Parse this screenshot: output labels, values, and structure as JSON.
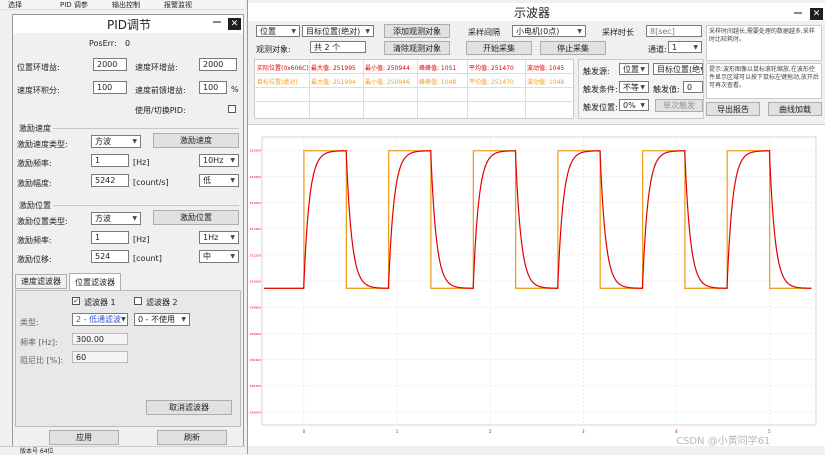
{
  "topbar": {
    "items": [
      "选择",
      "PID 调参",
      "输出控制",
      "报警监视"
    ]
  },
  "pid": {
    "title": "PID调节",
    "poserr_label": "PosErr:",
    "poserr_value": "0",
    "pos_gain_label": "位置环增益:",
    "pos_gain_value": "2000",
    "vel_gain_label": "速度环增益:",
    "vel_gain_value": "2000",
    "vel_int_label": "速度环积分:",
    "vel_int_value": "100",
    "vel_ff_label": "速度前馈增益:",
    "vel_ff_value": "100",
    "vel_ff_unit": "%",
    "switch_label": "使用/切换PID:",
    "vel_section": "激励速度",
    "vel_wave_label": "激励速度类型:",
    "vel_wave_value": "方波",
    "vel_btn": "激励速度",
    "vel_freq_label": "激励频率:",
    "vel_freq_value": "1",
    "vel_freq_unit": "[Hz]",
    "vel_freq_sel": "10Hz",
    "vel_amp_label": "激励幅度:",
    "vel_amp_value": "5242",
    "vel_amp_unit": "[count/s]",
    "vel_amp_sel": "低",
    "pos_section": "激励位置",
    "pos_wave_label": "激励位置类型:",
    "pos_wave_value": "方波",
    "pos_btn": "激励位置",
    "pos_freq_label": "激励频率:",
    "pos_freq_value": "1",
    "pos_freq_unit": "[Hz]",
    "pos_freq_sel": "1Hz",
    "pos_amp_label": "激励位移:",
    "pos_amp_value": "524",
    "pos_amp_unit": "[count]",
    "pos_amp_sel": "中",
    "tabs": [
      "速度滤波器",
      "位置滤波器"
    ],
    "filter1": "滤波器 1",
    "filter2": "滤波器 2",
    "type_label": "类型:",
    "type_value": "2 - 低通滤波",
    "type2_value": "0 - 不使用",
    "freq_label": "频率 [Hz]:",
    "freq_value": "300.00",
    "damp_label": "阻尼比 [%]:",
    "damp_value": "60",
    "filter_btn": "取消滤波器",
    "apply_btn": "应用",
    "refresh_btn": "刷新",
    "status": "版本号 64位"
  },
  "osc": {
    "title": "示波器",
    "ch_sel": "位置",
    "ch2_sel": "目标位置(绝对)",
    "add_btn": "添加观测对象",
    "trig_label": "采样间隔",
    "trig_sel": "小电机(0点)",
    "samp_label": "采样时长",
    "samp_value": "8[sec]",
    "obs_label": "观测对象:",
    "obs_value": "共 2 个",
    "clear_btn": "清除观测对象",
    "start_btn": "开始采集",
    "stop_btn": "停止采集",
    "chan_label": "通道:",
    "chan_value": "1",
    "rows": [
      {
        "name": "实际位置(0x606C)",
        "c1": "最大值: 251995",
        "c2": "最小值: 250944",
        "c3": "峰峰值: 1051",
        "c4": "平均值: 251470",
        "c5": "波动值: 1045"
      },
      {
        "name": "目标位置(绝对)",
        "c1": "最大值: 251994",
        "c2": "最小值: 250946",
        "c3": "峰峰值: 1048",
        "c4": "平均值: 251470",
        "c5": "波动值: 1048"
      }
    ],
    "trig_src_label": "触发源:",
    "trig_src_value": "位置",
    "trig_src2": "目标位置(绝",
    "trig_cond_label": "触发条件:",
    "trig_cond_value": "不等",
    "trig_val_label": "触发值:",
    "trig_val_value": "0",
    "trig_pos_label": "触发位置:",
    "trig_pos_value": "0%",
    "trig_single": "单次触发",
    "note1": "采样时间越长,需要处理的数据越多,采样时比较耗时。",
    "note2": "提示:波形图像以鼠标滚轮缩放,在波形控件显示区域可以按下鼠标左键拖动,放开后可再次查看。",
    "export_btn": "导出报告",
    "load_btn": "曲线加载",
    "watermark": "CSDN @小黄同学61"
  },
  "colors": {
    "actual": "#e00000",
    "target": "#f0a020",
    "grid": "#d8d8d8"
  },
  "chart_data": {
    "type": "line",
    "title": "",
    "xlabel": "",
    "ylabel": "",
    "x_ticks": [
      "0",
      "1",
      "2",
      "3",
      "4",
      "5"
    ],
    "y_ticks": [
      "250000",
      "250200",
      "250400",
      "250600",
      "250800",
      "251000",
      "251200",
      "251400",
      "251600",
      "251800",
      "252000"
    ],
    "ylim": [
      249900,
      252100
    ],
    "xlim": [
      -0.45,
      5.5
    ],
    "grid": true,
    "square_freq_hz": 1.1,
    "high": 251995,
    "low": 250944,
    "series": [
      {
        "name": "实际位置(0x606C)",
        "color": "#e00000",
        "kind": "response"
      },
      {
        "name": "目标位置(绝对)",
        "color": "#f0a020",
        "kind": "square"
      }
    ]
  }
}
